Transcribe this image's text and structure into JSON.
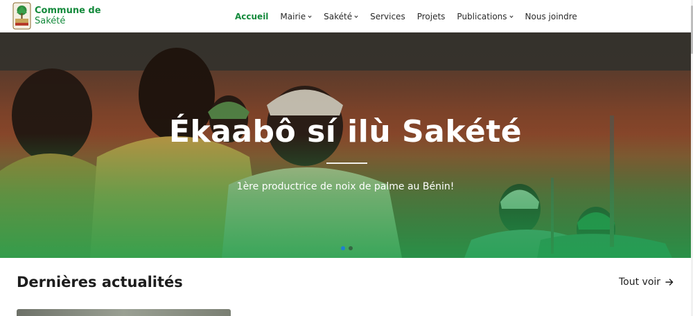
{
  "brand": {
    "line1": "Commune de",
    "line2": "Sakété"
  },
  "nav": {
    "items": [
      {
        "label": "Accueil",
        "active": true,
        "dropdown": false
      },
      {
        "label": "Mairie",
        "active": false,
        "dropdown": true
      },
      {
        "label": "Sakété",
        "active": false,
        "dropdown": true
      },
      {
        "label": "Services",
        "active": false,
        "dropdown": false
      },
      {
        "label": "Projets",
        "active": false,
        "dropdown": false
      },
      {
        "label": "Publications",
        "active": false,
        "dropdown": true
      },
      {
        "label": "Nous joindre",
        "active": false,
        "dropdown": false
      }
    ]
  },
  "hero": {
    "title": "Ékaabô sí ilù Sakété",
    "subtitle": "1ère productrice de noix de palme au Bénin!",
    "slides_count": 2,
    "active_slide": 1
  },
  "news": {
    "title": "Dernières actualités",
    "see_all": "Tout voir"
  },
  "colors": {
    "brand_green": "#148a3c",
    "active_dot": "#1f7fd1"
  },
  "icons": {
    "dropdown": "chevron-down-icon",
    "see_all": "arrow-right-icon"
  }
}
